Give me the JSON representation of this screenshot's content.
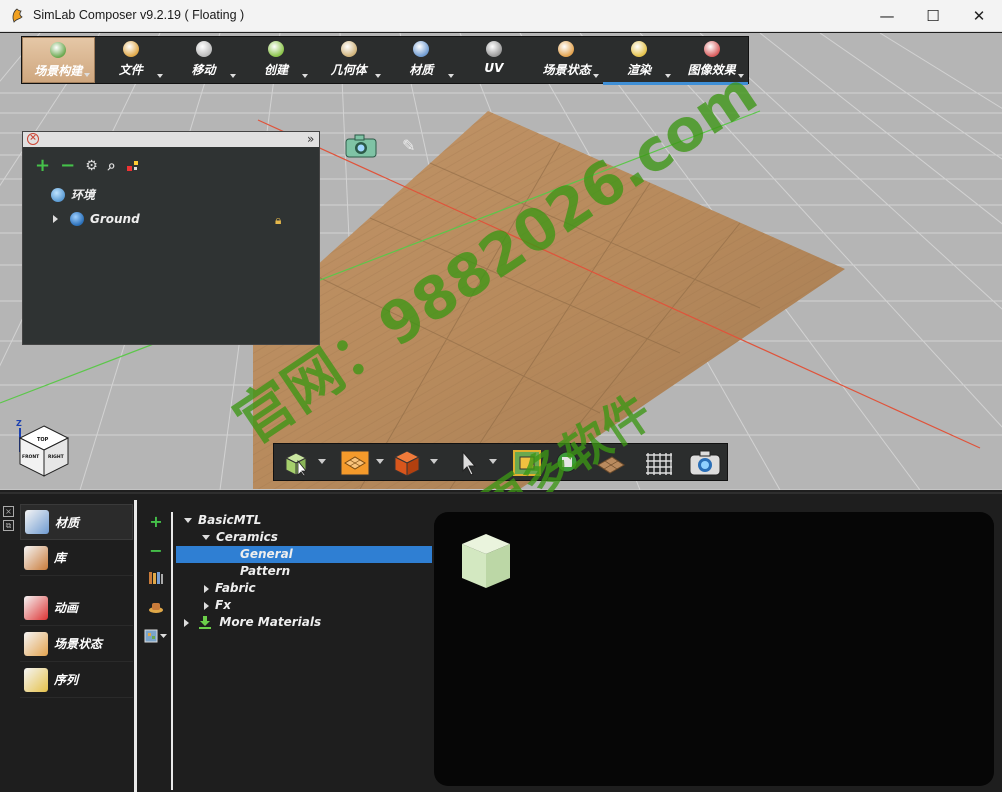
{
  "window": {
    "title": "SimLab Composer v9.2.19 ( Floating )",
    "controls": {
      "minimize": "—",
      "maximize": "☐",
      "close": "✕"
    }
  },
  "main_toolbar": {
    "items": [
      {
        "label": "场景构建",
        "active": true,
        "icon_color": "#6aa84f"
      },
      {
        "label": "文件",
        "icon_color": "#e0a848"
      },
      {
        "label": "移动",
        "icon_color": "#bbbbbb"
      },
      {
        "label": "创建",
        "icon_color": "#8bc34a"
      },
      {
        "label": "几何体",
        "icon_color": "#cfb27a"
      },
      {
        "label": "材质",
        "icon_color": "#6f9bd1"
      },
      {
        "label": "UV",
        "icon_color": "#999999"
      },
      {
        "label": "场景状态",
        "icon_color": "#e3a34f"
      },
      {
        "label": "渲染",
        "icon_color": "#e4c24b"
      },
      {
        "label": "图像效果",
        "icon_color": "#d85c5c"
      }
    ]
  },
  "scene_tree": {
    "tools": {
      "add": "+",
      "remove": "−",
      "settings": "⚙",
      "search": "🔍"
    },
    "items": [
      {
        "label": "环境",
        "icon": "environment-globe-icon"
      },
      {
        "label": "Ground",
        "icon": "globe-icon",
        "locked": true
      }
    ]
  },
  "axis_cube": {
    "top": "TOP",
    "front": "FRONT",
    "right": "RIGHT",
    "z": "Z"
  },
  "watermark": {
    "line1": "官网：9882026.com",
    "line2": "获取更多软件"
  },
  "bottom_nav": {
    "items": [
      {
        "label": "材质",
        "active": true,
        "icon_color": "#6f9bd1"
      },
      {
        "label": "库",
        "icon_color": "#c97b3a"
      },
      {
        "label": "动画",
        "icon_color": "#d33"
      },
      {
        "label": "场景状态",
        "icon_color": "#e3a34f"
      },
      {
        "label": "序列",
        "icon_color": "#e5c14a"
      }
    ]
  },
  "material_tree": {
    "tools": {
      "add": "+",
      "remove": "−"
    },
    "rows": [
      {
        "label": "BasicMTL",
        "depth": 0,
        "expanded": true
      },
      {
        "label": "Ceramics",
        "depth": 1,
        "expanded": true
      },
      {
        "label": "General",
        "depth": 2,
        "selected": true
      },
      {
        "label": "Pattern",
        "depth": 2
      },
      {
        "label": "Fabric",
        "depth": 1,
        "expanded": false
      },
      {
        "label": "Fx",
        "depth": 1,
        "expanded": false
      },
      {
        "label": "More Materials",
        "depth": 0,
        "expanded": false,
        "download": true
      }
    ]
  },
  "colors": {
    "accent_blue": "#2f7fd3",
    "active_tab": "#d9b48f",
    "panel_bg": "#2f3333",
    "floor_wood": "#b98a5e"
  }
}
